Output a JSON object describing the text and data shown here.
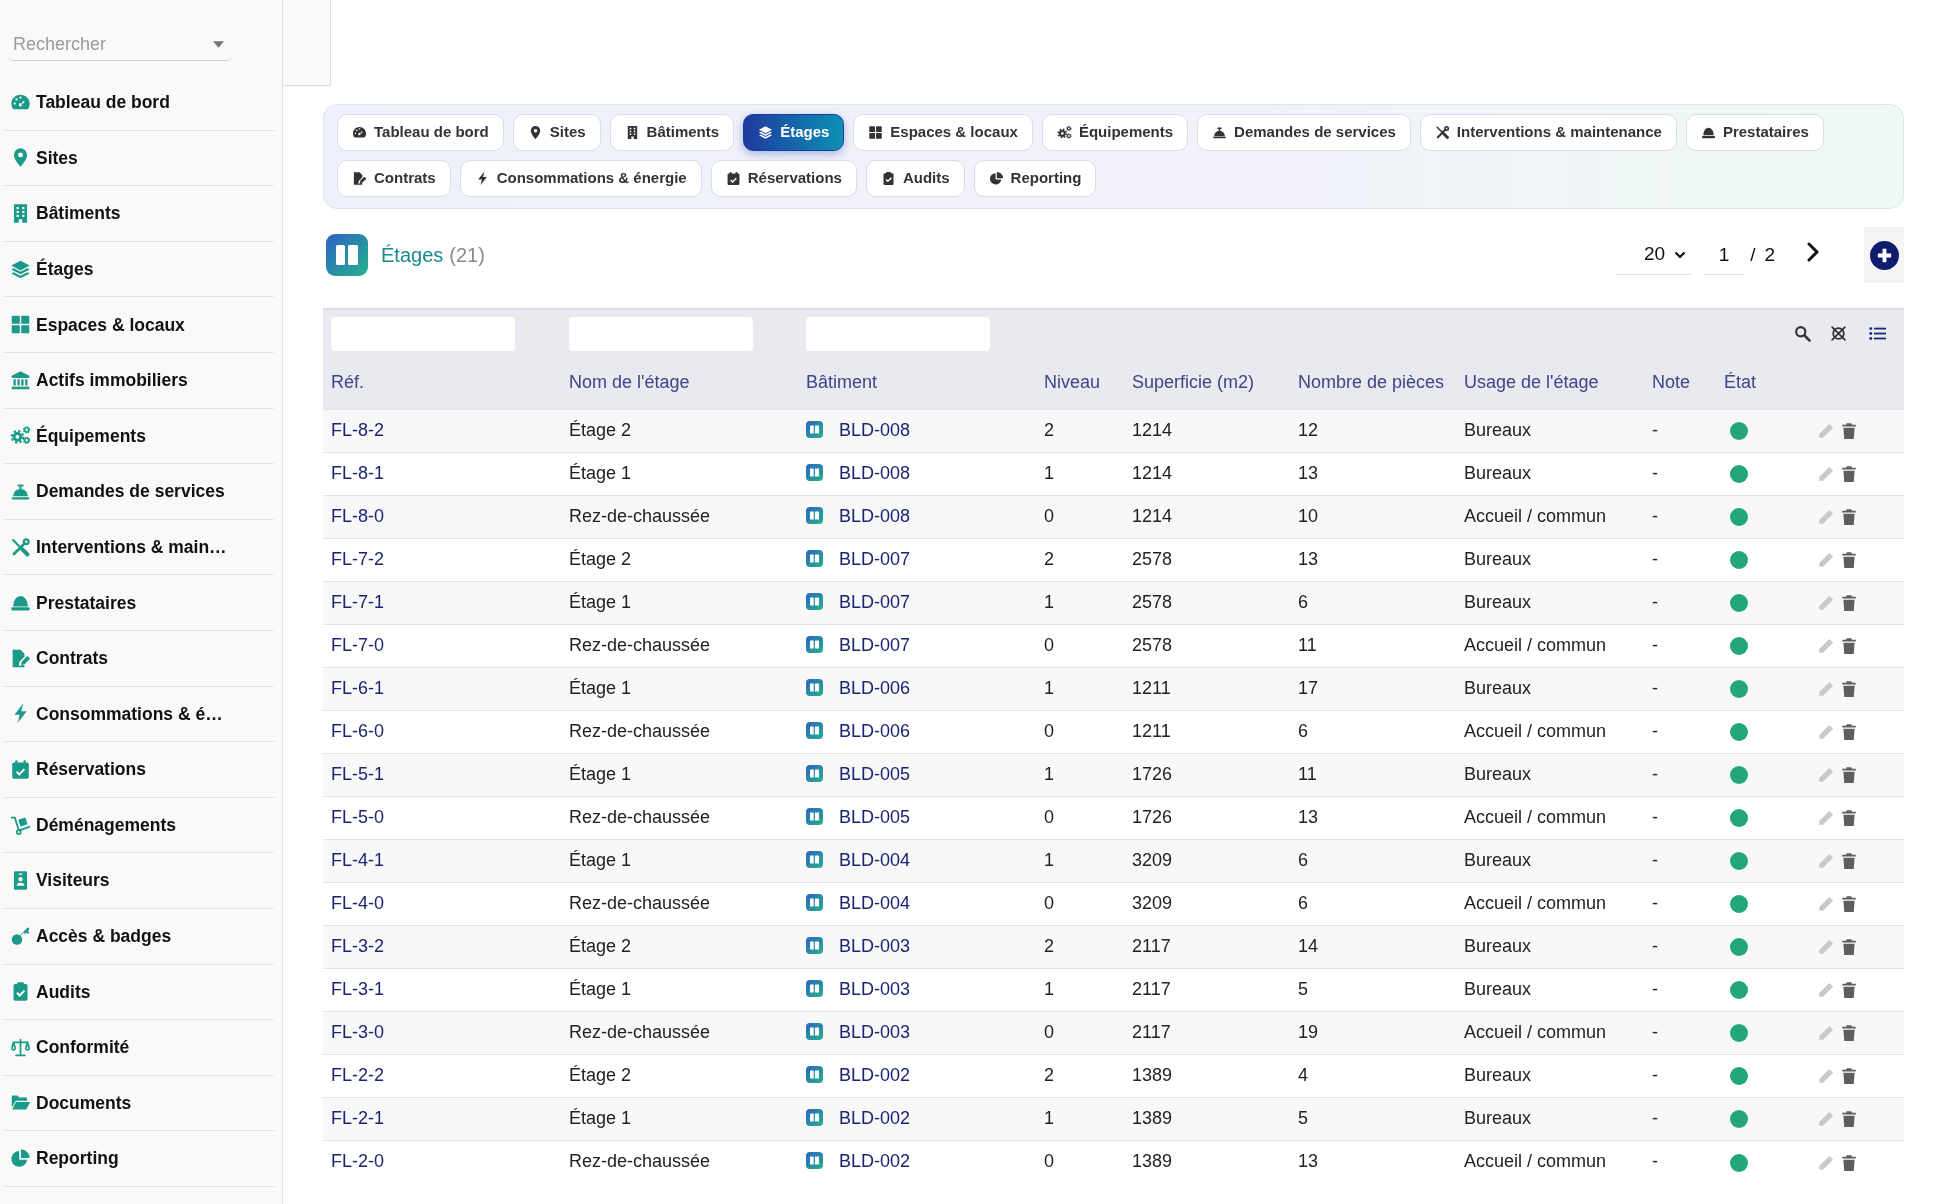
{
  "sidebar": {
    "search": {
      "placeholder": "Rechercher"
    },
    "items": [
      {
        "label": "Tableau de bord"
      },
      {
        "label": "Sites"
      },
      {
        "label": "Bâtiments"
      },
      {
        "label": "Étages"
      },
      {
        "label": "Espaces & locaux"
      },
      {
        "label": "Actifs immobiliers"
      },
      {
        "label": "Équipements"
      },
      {
        "label": "Demandes de services"
      },
      {
        "label": "Interventions & main…"
      },
      {
        "label": "Prestataires"
      },
      {
        "label": "Contrats"
      },
      {
        "label": "Consommations & é…"
      },
      {
        "label": "Réservations"
      },
      {
        "label": "Déménagements"
      },
      {
        "label": "Visiteurs"
      },
      {
        "label": "Accès & badges"
      },
      {
        "label": "Audits"
      },
      {
        "label": "Conformité"
      },
      {
        "label": "Documents"
      },
      {
        "label": "Reporting"
      }
    ]
  },
  "tabs": [
    {
      "label": "Tableau de bord",
      "selected": false
    },
    {
      "label": "Sites",
      "selected": false
    },
    {
      "label": "Bâtiments",
      "selected": false
    },
    {
      "label": "Étages",
      "selected": true
    },
    {
      "label": "Espaces & locaux",
      "selected": false
    },
    {
      "label": "Équipements",
      "selected": false
    },
    {
      "label": "Demandes de services",
      "selected": false
    },
    {
      "label": "Interventions & maintenance",
      "selected": false
    },
    {
      "label": "Prestataires",
      "selected": false
    },
    {
      "label": "Contrats",
      "selected": false
    },
    {
      "label": "Consommations & énergie",
      "selected": false
    },
    {
      "label": "Réservations",
      "selected": false
    },
    {
      "label": "Audits",
      "selected": false
    },
    {
      "label": "Reporting",
      "selected": false
    }
  ],
  "header": {
    "title": "Étages",
    "count": "(21)"
  },
  "pagination": {
    "page_size": "20",
    "page": "1",
    "separator": "/",
    "page_count": "2"
  },
  "table": {
    "columns": [
      {
        "label": "Réf.",
        "filter": true
      },
      {
        "label": "Nom de l'étage",
        "filter": true
      },
      {
        "label": "Bâtiment",
        "filter": true
      },
      {
        "label": "Niveau",
        "filter": false
      },
      {
        "label": "Superficie (m2)",
        "filter": false
      },
      {
        "label": "Nombre de pièces",
        "filter": false
      },
      {
        "label": "Usage de l'étage",
        "filter": false
      },
      {
        "label": "Note",
        "filter": false
      },
      {
        "label": "État",
        "filter": false
      }
    ],
    "rows": [
      {
        "ref": "FL-8-2",
        "name": "Étage 2",
        "building": "BLD-008",
        "floor": "2",
        "area": "1214",
        "rooms": "12",
        "usage": "Bureaux",
        "note": "-",
        "color": "#23a67c"
      },
      {
        "ref": "FL-8-1",
        "name": "Étage 1",
        "building": "BLD-008",
        "floor": "1",
        "area": "1214",
        "rooms": "13",
        "usage": "Bureaux",
        "note": "-",
        "color": "#23a67c"
      },
      {
        "ref": "FL-8-0",
        "name": "Rez-de-chaussée",
        "building": "BLD-008",
        "floor": "0",
        "area": "1214",
        "rooms": "10",
        "usage": "Accueil / commun",
        "note": "-",
        "color": "#23a67c"
      },
      {
        "ref": "FL-7-2",
        "name": "Étage 2",
        "building": "BLD-007",
        "floor": "2",
        "area": "2578",
        "rooms": "13",
        "usage": "Bureaux",
        "note": "-",
        "color": "#23a67c"
      },
      {
        "ref": "FL-7-1",
        "name": "Étage 1",
        "building": "BLD-007",
        "floor": "1",
        "area": "2578",
        "rooms": "6",
        "usage": "Bureaux",
        "note": "-",
        "color": "#23a67c"
      },
      {
        "ref": "FL-7-0",
        "name": "Rez-de-chaussée",
        "building": "BLD-007",
        "floor": "0",
        "area": "2578",
        "rooms": "11",
        "usage": "Accueil / commun",
        "note": "-",
        "color": "#23a67c"
      },
      {
        "ref": "FL-6-1",
        "name": "Étage 1",
        "building": "BLD-006",
        "floor": "1",
        "area": "1211",
        "rooms": "17",
        "usage": "Bureaux",
        "note": "-",
        "color": "#23a67c"
      },
      {
        "ref": "FL-6-0",
        "name": "Rez-de-chaussée",
        "building": "BLD-006",
        "floor": "0",
        "area": "1211",
        "rooms": "6",
        "usage": "Accueil / commun",
        "note": "-",
        "color": "#23a67c"
      },
      {
        "ref": "FL-5-1",
        "name": "Étage 1",
        "building": "BLD-005",
        "floor": "1",
        "area": "1726",
        "rooms": "11",
        "usage": "Bureaux",
        "note": "-",
        "color": "#23a67c"
      },
      {
        "ref": "FL-5-0",
        "name": "Rez-de-chaussée",
        "building": "BLD-005",
        "floor": "0",
        "area": "1726",
        "rooms": "13",
        "usage": "Accueil / commun",
        "note": "-",
        "color": "#23a67c"
      },
      {
        "ref": "FL-4-1",
        "name": "Étage 1",
        "building": "BLD-004",
        "floor": "1",
        "area": "3209",
        "rooms": "6",
        "usage": "Bureaux",
        "note": "-",
        "color": "#23a67c"
      },
      {
        "ref": "FL-4-0",
        "name": "Rez-de-chaussée",
        "building": "BLD-004",
        "floor": "0",
        "area": "3209",
        "rooms": "6",
        "usage": "Accueil / commun",
        "note": "-",
        "color": "#23a67c"
      },
      {
        "ref": "FL-3-2",
        "name": "Étage 2",
        "building": "BLD-003",
        "floor": "2",
        "area": "2117",
        "rooms": "14",
        "usage": "Bureaux",
        "note": "-",
        "color": "#23a67c"
      },
      {
        "ref": "FL-3-1",
        "name": "Étage 1",
        "building": "BLD-003",
        "floor": "1",
        "area": "2117",
        "rooms": "5",
        "usage": "Bureaux",
        "note": "-",
        "color": "#23a67c"
      },
      {
        "ref": "FL-3-0",
        "name": "Rez-de-chaussée",
        "building": "BLD-003",
        "floor": "0",
        "area": "2117",
        "rooms": "19",
        "usage": "Accueil / commun",
        "note": "-",
        "color": "#23a67c"
      },
      {
        "ref": "FL-2-2",
        "name": "Étage 2",
        "building": "BLD-002",
        "floor": "2",
        "area": "1389",
        "rooms": "4",
        "usage": "Bureaux",
        "note": "-",
        "color": "#23a67c"
      },
      {
        "ref": "FL-2-1",
        "name": "Étage 1",
        "building": "BLD-002",
        "floor": "1",
        "area": "1389",
        "rooms": "5",
        "usage": "Bureaux",
        "note": "-",
        "color": "#23a67c"
      },
      {
        "ref": "FL-2-0",
        "name": "Rez-de-chaussée",
        "building": "BLD-002",
        "floor": "0",
        "area": "1389",
        "rooms": "13",
        "usage": "Accueil / commun",
        "note": "-",
        "color": "#23a67c"
      }
    ]
  }
}
